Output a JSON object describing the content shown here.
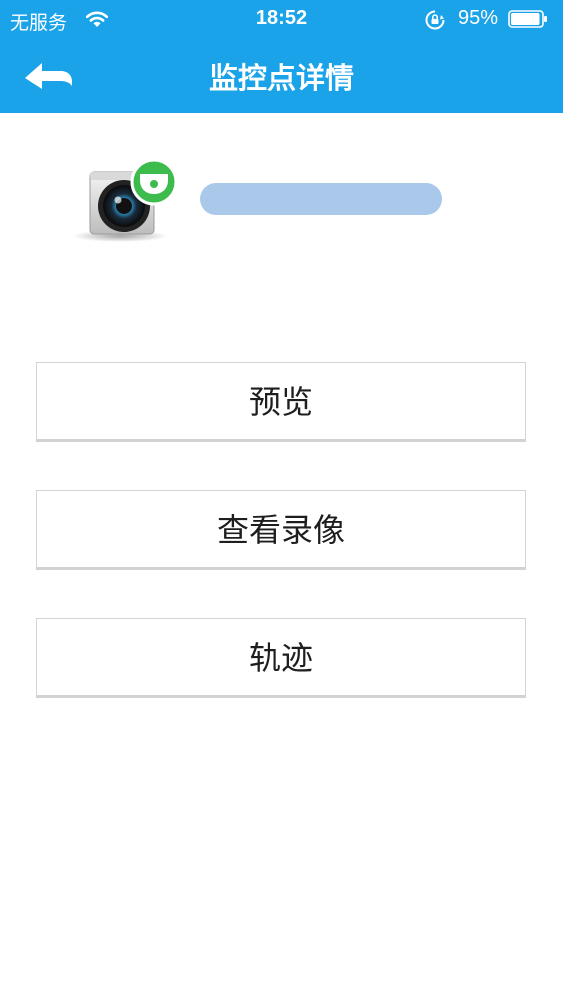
{
  "status_bar": {
    "carrier": "无服务",
    "time": "18:52",
    "battery_percent": "95%",
    "battery_level": 0.95,
    "icons": [
      "wifi-icon",
      "rotation-lock-icon",
      "battery-icon"
    ]
  },
  "nav": {
    "title": "监控点详情",
    "back_icon": "back-arrow-icon"
  },
  "camera": {
    "icon": "surveillance-camera-icon",
    "status_badge_icon": "dome-camera-online-icon",
    "name": ""
  },
  "actions": {
    "preview_label": "预览",
    "playback_label": "查看录像",
    "track_label": "轨迹"
  },
  "colors": {
    "header_bg": "#1aa3e8",
    "online_badge": "#3dbb4d",
    "redaction": "#a9c8ea",
    "button_text": "#1e1e1e",
    "button_border": "#d4d4d4"
  }
}
